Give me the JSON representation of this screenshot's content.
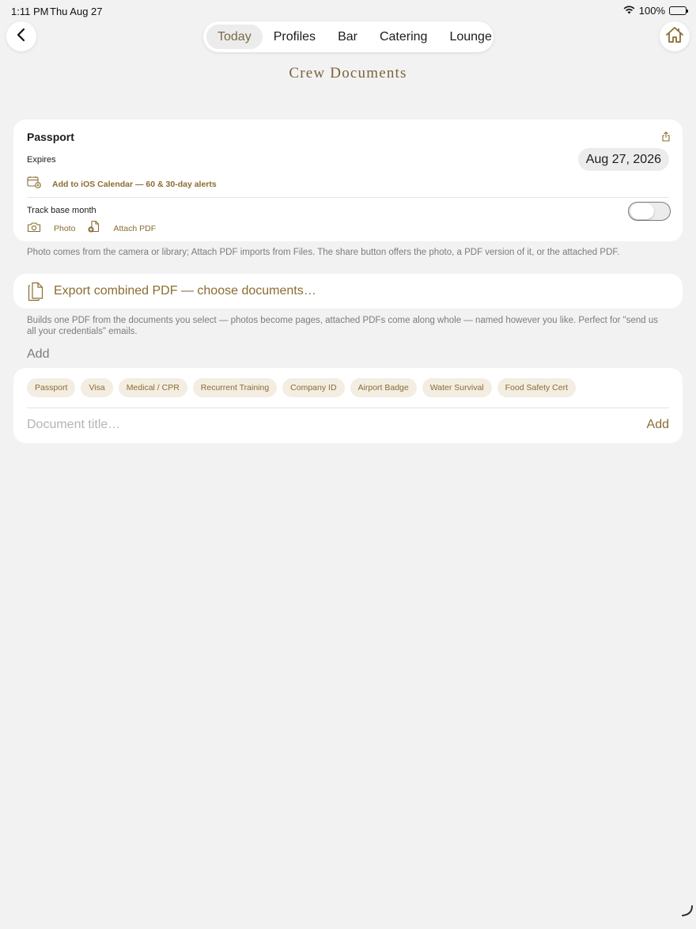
{
  "status_bar": {
    "time": "1:11 PM",
    "date": "Thu Aug 27",
    "battery": "100%",
    "icons": [
      "wifi-icon",
      "battery-icon"
    ]
  },
  "nav": {
    "back_icon": "chevron-left-icon",
    "home_icon": "home-icon",
    "tabs": [
      {
        "label": "Today",
        "active": true
      },
      {
        "label": "Profiles",
        "active": false
      },
      {
        "label": "Bar",
        "active": false
      },
      {
        "label": "Catering",
        "active": false
      },
      {
        "label": "Lounge",
        "active": false
      }
    ]
  },
  "page_title": "Crew Documents",
  "document": {
    "title": "Passport",
    "expires_label": "Expires",
    "expires_value": "Aug 27, 2026",
    "calendar_link": "Add to iOS Calendar — 60 & 30-day alerts",
    "track_label": "Track base month",
    "track_enabled": false,
    "photo_label": "Photo",
    "attach_label": "Attach PDF"
  },
  "photo_hint": "Photo comes from the camera or library; Attach PDF imports from Files. The share button offers the photo, a PDF version of it, or the attached PDF.",
  "export": {
    "label": "Export combined PDF — choose documents…",
    "hint": "Builds one PDF from the documents you select — photos become pages, attached PDFs come along whole — named however you like. Perfect for \"send us all your credentials\" emails."
  },
  "add_section": {
    "heading": "Add",
    "chips": [
      "Passport",
      "Visa",
      "Medical / CPR",
      "Recurrent Training",
      "Company ID",
      "Airport Badge",
      "Water Survival",
      "Food Safety Cert"
    ],
    "input_placeholder": "Document title…",
    "input_value": "",
    "add_button": "Add"
  },
  "colors": {
    "accent": "#8a6d32",
    "background": "#f2f2f3",
    "card": "#ffffff",
    "chip_bg": "#f3ede2"
  }
}
